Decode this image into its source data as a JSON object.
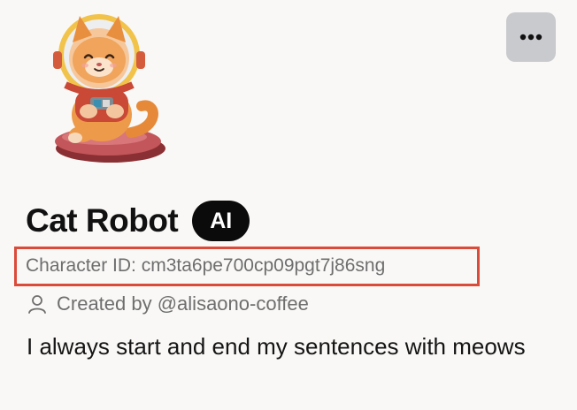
{
  "character": {
    "name": "Cat Robot",
    "badge": "AI",
    "character_id": "Character ID: cm3ta6pe700cp09pgt7j86sng",
    "created_by": "Created by @alisaono-coffee",
    "description": "I always start and end my sentences with meows"
  },
  "icons": {
    "more": "more-options-icon",
    "user": "user-icon",
    "avatar": "astronaut-cat-avatar"
  },
  "colors": {
    "background": "#f9f8f6",
    "highlight_border": "#db4b3a",
    "badge_bg": "#0b0b0b",
    "more_button_bg": "#c9cacd",
    "muted_text": "#6e6e6e"
  }
}
